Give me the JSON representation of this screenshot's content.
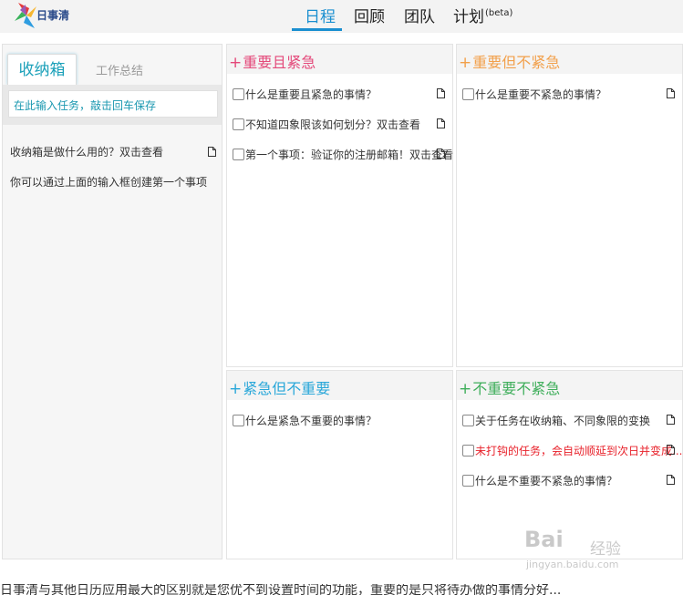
{
  "app": {
    "logo_text": "日事清"
  },
  "nav": {
    "tabs": [
      {
        "label": "日程",
        "active": true
      },
      {
        "label": "回顾"
      },
      {
        "label": "团队"
      },
      {
        "label": "计划",
        "badge": "(beta)"
      }
    ],
    "accent": "#1a8fd0"
  },
  "inbox": {
    "tabs": [
      "收纳箱",
      "工作总结"
    ],
    "input_placeholder": "在此输入任务，敲击回车保存",
    "items": [
      "收纳箱是做什么用的？双击查看",
      "你可以通过上面的输入框创建第一个事项"
    ]
  },
  "quadrants": [
    {
      "title": "重要且紧急",
      "color": "#e4497a",
      "tasks": [
        {
          "text": "什么是重要且紧急的事情？"
        },
        {
          "text": "不知道四象限该如何划分？双击查看"
        },
        {
          "text": "第一个事项：验证你的注册邮箱！双击查看"
        }
      ]
    },
    {
      "title": "重要但不紧急",
      "color": "#f2a04b",
      "tasks": [
        {
          "text": "什么是重要不紧急的事情？"
        }
      ]
    },
    {
      "title": "紧急但不重要",
      "color": "#29a7d9",
      "tasks": [
        {
          "text": "什么是紧急不重要的事情？"
        }
      ]
    },
    {
      "title": "不重要不紧急",
      "color": "#3fae5b",
      "tasks": [
        {
          "text": "关于任务在收纳箱、不同象限的变换"
        },
        {
          "text": "未打钩的任务，会自动顺延到次日并变成...",
          "red": true
        },
        {
          "text": "什么是不重要不紧急的事情？"
        }
      ]
    }
  ],
  "watermark": {
    "logo": "Bai",
    "cn": "经验",
    "url": "jingyan.baidu.com"
  },
  "caption": "日事清与其他日历应用最大的区别就是您优不到设置时间的功能，重要的是只将待办做的事情分好..."
}
